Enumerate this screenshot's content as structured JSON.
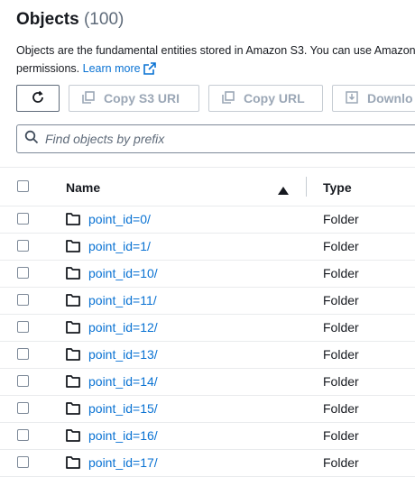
{
  "header": {
    "title": "Objects",
    "count": "(100)",
    "description_line1": "Objects are the fundamental entities stored in Amazon S3. You can use Amazon S",
    "description_line2": "permissions.",
    "learn_more": "Learn more"
  },
  "toolbar": {
    "refresh_icon": "refresh-icon",
    "copy_s3_uri": "Copy S3 URI",
    "copy_url": "Copy URL",
    "download": "Downlo"
  },
  "search": {
    "placeholder": "Find objects by prefix"
  },
  "table": {
    "columns": [
      "Name",
      "Type"
    ],
    "sort": "ascending",
    "rows": [
      {
        "name": "point_id=0/",
        "type": "Folder"
      },
      {
        "name": "point_id=1/",
        "type": "Folder"
      },
      {
        "name": "point_id=10/",
        "type": "Folder"
      },
      {
        "name": "point_id=11/",
        "type": "Folder"
      },
      {
        "name": "point_id=12/",
        "type": "Folder"
      },
      {
        "name": "point_id=13/",
        "type": "Folder"
      },
      {
        "name": "point_id=14/",
        "type": "Folder"
      },
      {
        "name": "point_id=15/",
        "type": "Folder"
      },
      {
        "name": "point_id=16/",
        "type": "Folder"
      },
      {
        "name": "point_id=17/",
        "type": "Folder"
      }
    ]
  },
  "colors": {
    "link": "#0972d3",
    "text": "#16191f",
    "disabled": "#9ba7b6",
    "border": "#e9ebed"
  }
}
